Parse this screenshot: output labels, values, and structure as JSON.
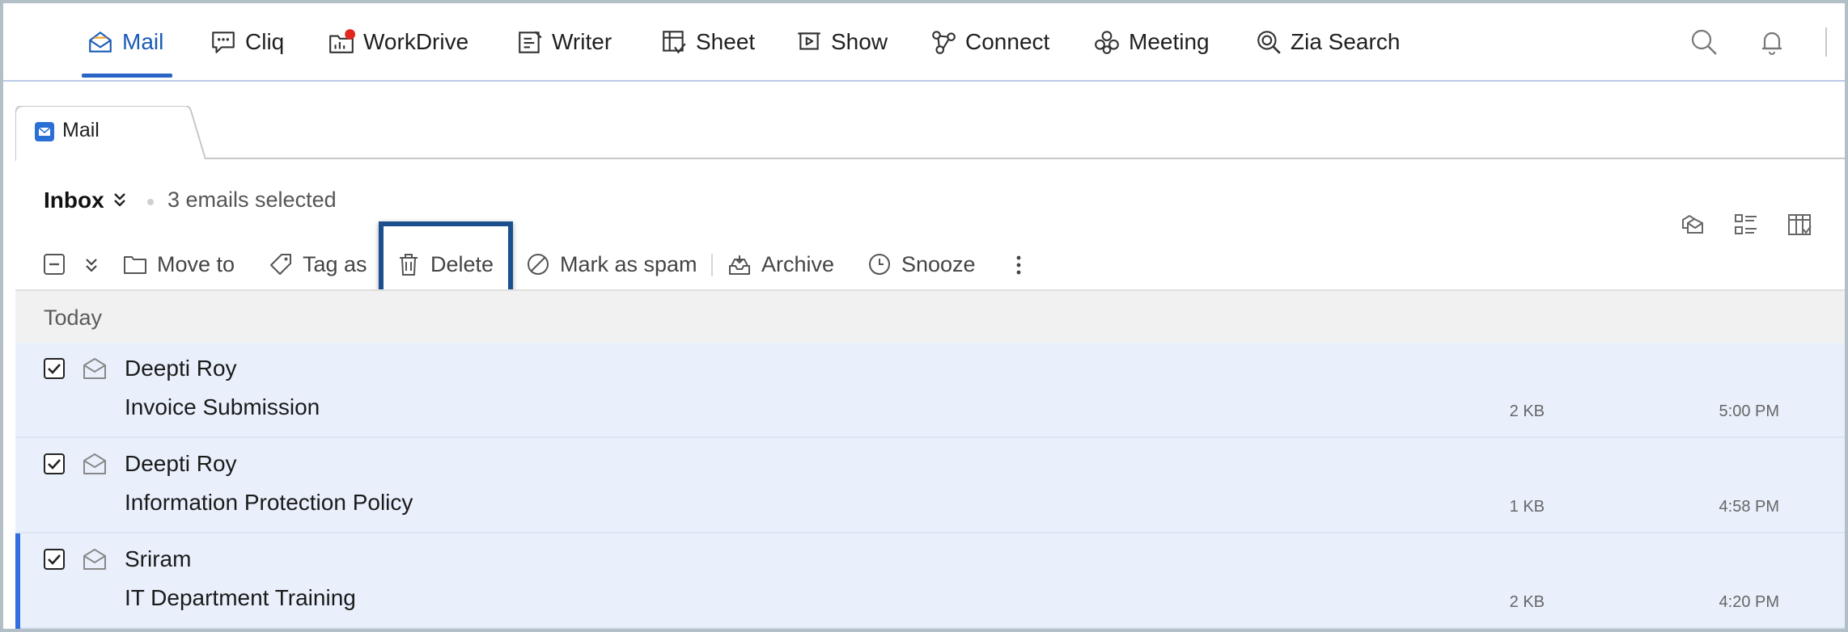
{
  "nav": {
    "apps": [
      {
        "label": "Mail",
        "icon": "mail-icon",
        "active": true
      },
      {
        "label": "Cliq",
        "icon": "chat-icon"
      },
      {
        "label": "WorkDrive",
        "icon": "workdrive-icon"
      },
      {
        "label": "Writer",
        "icon": "writer-icon"
      },
      {
        "label": "Sheet",
        "icon": "sheet-icon"
      },
      {
        "label": "Show",
        "icon": "show-icon"
      },
      {
        "label": "Connect",
        "icon": "connect-icon"
      },
      {
        "label": "Meeting",
        "icon": "meeting-icon"
      },
      {
        "label": "Zia Search",
        "icon": "zia-search-icon"
      }
    ],
    "right_icons": [
      "search-icon",
      "bell-icon"
    ],
    "accent_color": "#2a64c6",
    "notification_color": "#e0281e"
  },
  "tab": {
    "label": "Mail",
    "icon": "mail-tab-icon"
  },
  "list_header": {
    "folder": "Inbox",
    "selected_text": "3 emails selected",
    "view_icons": [
      "conversation-view-icon",
      "list-view-icon",
      "column-view-icon"
    ]
  },
  "toolbar": {
    "move_to": "Move to",
    "tag_as": "Tag as",
    "delete": "Delete",
    "mark_as_spam": "Mark as spam",
    "archive": "Archive",
    "snooze": "Snooze",
    "highlight_color": "#1c4f8e"
  },
  "group": {
    "label": "Today"
  },
  "emails": [
    {
      "sender": "Deepti Roy",
      "subject": "Invoice Submission",
      "size": "2 KB",
      "time": "5:00 PM",
      "checked": true
    },
    {
      "sender": "Deepti Roy",
      "subject": "Information Protection Policy",
      "size": "1 KB",
      "time": "4:58 PM",
      "checked": true
    },
    {
      "sender": "Sriram",
      "subject": "IT Department Training",
      "size": "2 KB",
      "time": "4:20 PM",
      "checked": true
    }
  ]
}
